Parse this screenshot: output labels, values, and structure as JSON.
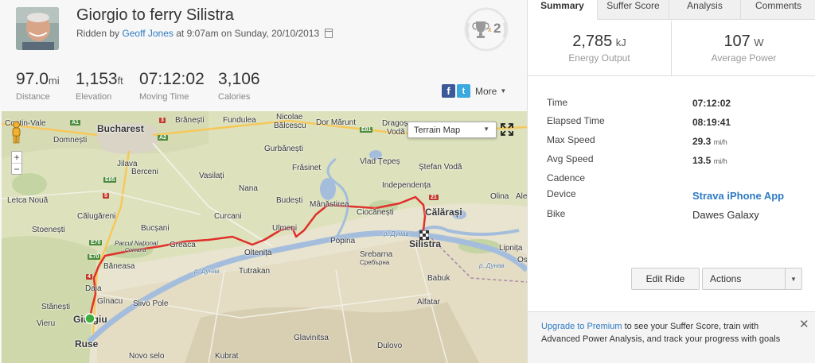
{
  "activity": {
    "title": "Giorgio to ferry Silistra",
    "ridden_by": "Ridden by",
    "athlete": "Geoff Jones",
    "time_text": "at 9:07am on Sunday, 20/10/2013",
    "achievement_count": "2",
    "achievement_x": "x"
  },
  "stats": [
    {
      "value": "97.0",
      "unit": "mi",
      "label": "Distance"
    },
    {
      "value": "1,153",
      "unit": "ft",
      "label": "Elevation"
    },
    {
      "value": "07:12:02",
      "unit": "",
      "label": "Moving Time"
    },
    {
      "value": "3,106",
      "unit": "",
      "label": "Calories"
    }
  ],
  "share": {
    "facebook_glyph": "f",
    "twitter_glyph": "t",
    "more_label": "More"
  },
  "map": {
    "map_type": "Terrain Map",
    "zoom_in": "+",
    "zoom_out": "−",
    "places": {
      "bucharest": "Bucharest",
      "braila": "Brănești",
      "fundulea": "Fundulea",
      "nicolae": "Nicolae",
      "balcescu": "Bălcescu",
      "dormarunt": "Dor Mărunt",
      "dragos": "Dragoș",
      "voda": "Vodă",
      "contin": "Contin-Vale",
      "domnesti": "Domnești",
      "gurbanesti": "Gurbănești",
      "jilava": "Jilava",
      "berceni": "Berceni",
      "vasilati": "Vasilați",
      "frasinet": "Frăsinet",
      "vladtepes": "Vlad Țepeș",
      "stefanvoda": "Ștefan Vodă",
      "letca": "Letca Nouă",
      "nana": "Nana",
      "budesti": "Budești",
      "independenta": "Independența",
      "olina": "Olina",
      "alex": "Alex",
      "calugareni": "Călugăreni",
      "curcani": "Curcani",
      "manastirea": "Mânăstirea",
      "ciocanesti": "Ciocănești",
      "calarasi": "Călărași",
      "stoenesti": "Stoenești",
      "bucsani": "Bucșani",
      "ulmeni": "Ulmeni",
      "parcnat": "Parcul Național",
      "comana": "Comana",
      "greaca": "Greaca",
      "popina": "Popina",
      "silistra": "Silistra",
      "lipnita": "Lipnița",
      "baneasa": "Băneasa",
      "oltenita": "Oltenița",
      "srebarna": "Srebarna",
      "srebarna_cyr": "Сребърна",
      "daia": "Daia",
      "tutrakan": "Tutrakan",
      "babuk": "Babuk",
      "ostrov": "Os",
      "stanesti": "Stănești",
      "ginacu": "Gînacu",
      "slivopole": "Slivo Pole",
      "alfatar": "Alfatar",
      "vieru": "Vieru",
      "giurgiu": "Giurgiu",
      "glavinitsa": "Glavinitsa",
      "ruse": "Ruse",
      "dulovo": "Dulovo",
      "novoselo": "Novo selo",
      "kubrat": "Kubrat",
      "danube1": "р. Дунав",
      "danube2": "р. Дунав",
      "danube3": "р. Дунав"
    },
    "road_shields": {
      "a1": "A1",
      "a2": "A2",
      "e81": "E81",
      "e85": "E85",
      "r5": "5",
      "e70": "E70",
      "r3": "3",
      "r21": "21",
      "e70b": "E70",
      "dn4": "4"
    }
  },
  "tabs": [
    "Summary",
    "Suffer Score",
    "Analysis",
    "Comments"
  ],
  "metrics": [
    {
      "value": "2,785",
      "unit": "kJ",
      "label": "Energy Output"
    },
    {
      "value": "107",
      "unit": "W",
      "label": "Average Power"
    }
  ],
  "details": {
    "time_label": "Time",
    "time_value": "07:12:02",
    "elapsed_label": "Elapsed Time",
    "elapsed_value": "08:19:41",
    "max_speed_label": "Max Speed",
    "max_speed_value": "29.3",
    "max_speed_unit": "mi/h",
    "avg_speed_label": "Avg Speed",
    "avg_speed_value": "13.5",
    "avg_speed_unit": "mi/h",
    "cadence_label": "Cadence",
    "device_label": "Device",
    "device_value": "Strava iPhone App",
    "bike_label": "Bike",
    "bike_value": "Dawes Galaxy"
  },
  "buttons": {
    "edit_ride": "Edit Ride",
    "actions": "Actions"
  },
  "promo": {
    "link": "Upgrade to Premium",
    "text": "to see your Suffer Score, train with Advanced Power Analysis, and track your progress with goals",
    "close": "✕"
  },
  "colors": {
    "accent_link": "#2f7bc4",
    "route": "#e0302b",
    "start_marker": "#3fb03f"
  }
}
